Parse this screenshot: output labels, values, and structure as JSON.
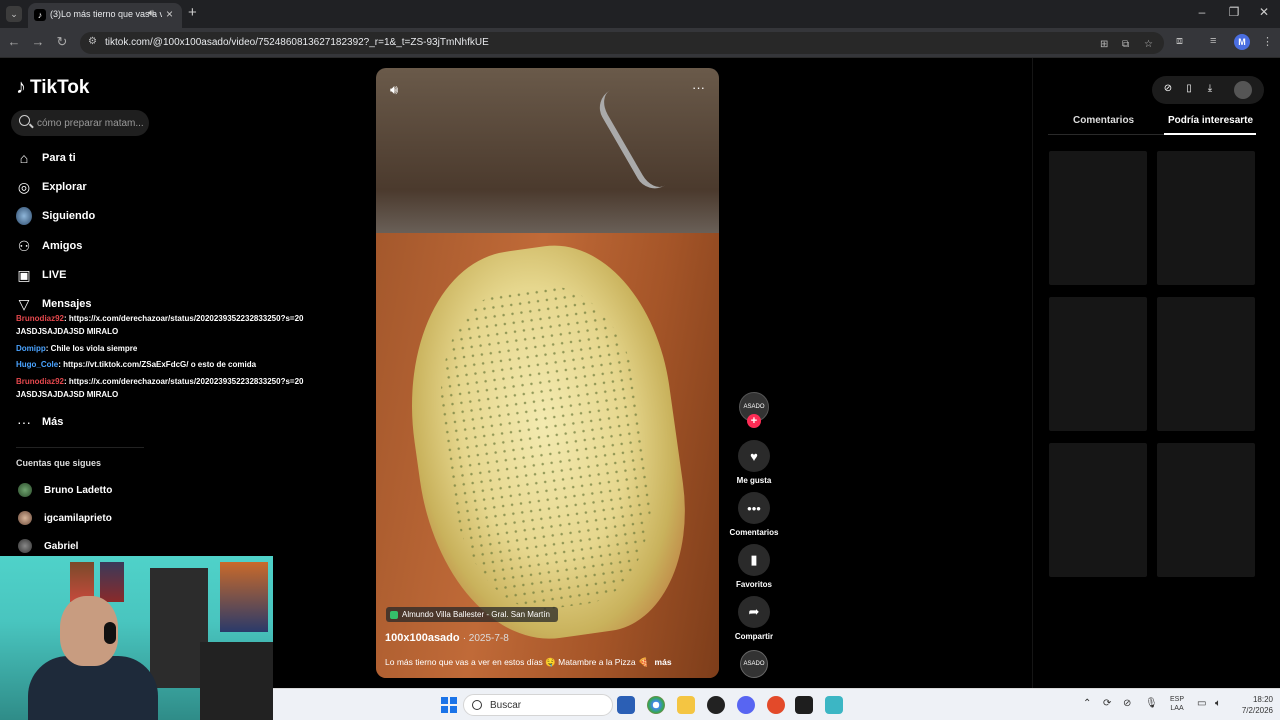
{
  "browser": {
    "tab_title": "(3)Lo más tierno que vas a ve",
    "url": "tiktok.com/@100x100asado/video/7524860813627182392?_r=1&_t=ZS-93jTmNhfkUE",
    "profile_initial": "M"
  },
  "tiktok": {
    "logo": "TikTok",
    "search_placeholder": "cómo preparar matam...",
    "nav": [
      {
        "label": "Para ti",
        "icon": "home-icon"
      },
      {
        "label": "Explorar",
        "icon": "compass-icon"
      },
      {
        "label": "Siguiendo",
        "icon": "following-avatar"
      },
      {
        "label": "Amigos",
        "icon": "friends-icon"
      },
      {
        "label": "LIVE",
        "icon": "live-icon"
      },
      {
        "label": "Mensajes",
        "icon": "messages-icon"
      },
      {
        "label": "Más",
        "icon": "more-icon"
      }
    ],
    "following_title": "Cuentas que sigues",
    "following": [
      {
        "name": "Bruno Ladetto"
      },
      {
        "name": "igcamilaprieto"
      },
      {
        "name": "Gabriel"
      }
    ]
  },
  "chat_overlay": [
    {
      "user": "Brunodiaz92",
      "message": ": https://x.com/derechazoar/status/2020239352232833250?s=20",
      "color": "#e5484d"
    },
    {
      "user": "",
      "message": "JASDJSAJDAJSD MIRALO",
      "color": "#ffffff"
    },
    {
      "user": "Domipp",
      "message": ": Chile los viola siempre",
      "color": "#4aa3ff"
    },
    {
      "user": "Hugo_Cole",
      "message": ": https://vt.tiktok.com/ZSaExFdcG/ o esto de comida",
      "color": "#4aa3ff"
    },
    {
      "user": "Brunodiaz92",
      "message": ": https://x.com/derechazoar/status/2020239352232833250?s=20",
      "color": "#e5484d"
    },
    {
      "user": "",
      "message": "JASDJSAJDAJSD MIRALO",
      "color": "#ffffff"
    }
  ],
  "video": {
    "location": "Almundo Villa Ballester - Gral. San Martín",
    "author": "100x100asado",
    "date": "· 2025-7-8",
    "description": "Lo más tierno que vas a ver en estos días 🤤 Matambre a la Pizza 🍕",
    "more": "más",
    "avatar_text": "ASADO"
  },
  "actions": [
    {
      "label": "Me gusta",
      "icon": "heart-icon"
    },
    {
      "label": "Comentarios",
      "icon": "comment-icon"
    },
    {
      "label": "Favoritos",
      "icon": "bookmark-icon"
    },
    {
      "label": "Compartir",
      "icon": "share-icon"
    }
  ],
  "right_panel": {
    "tabs": [
      "Comentarios",
      "Podría interesarte"
    ],
    "active_tab": "Podría interesarte"
  },
  "taskbar": {
    "search_label": "Buscar",
    "lang": "ESP\nLAA",
    "time": "18:20",
    "date": "7/2/2026"
  }
}
